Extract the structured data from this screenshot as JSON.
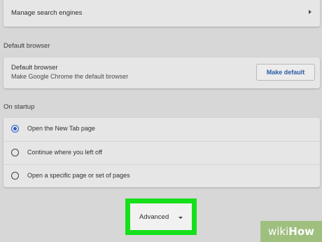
{
  "search": {
    "manage_engines_label": "Manage search engines"
  },
  "default_browser": {
    "section_title": "Default browser",
    "row_title": "Default browser",
    "row_subtitle": "Make Google Chrome the default browser",
    "make_default_button": "Make default"
  },
  "startup": {
    "section_title": "On startup",
    "options": [
      {
        "label": "Open the New Tab page",
        "selected": true
      },
      {
        "label": "Continue where you left off",
        "selected": false
      },
      {
        "label": "Open a specific page or set of pages",
        "selected": false
      }
    ]
  },
  "advanced": {
    "label": "Advanced",
    "highlight_color": "#16e01b"
  },
  "watermark": {
    "part1": "wiki",
    "part2": "How"
  },
  "colors": {
    "accent": "#2f5ec4",
    "background": "#d7d7d7",
    "card": "#e6e6e6"
  }
}
